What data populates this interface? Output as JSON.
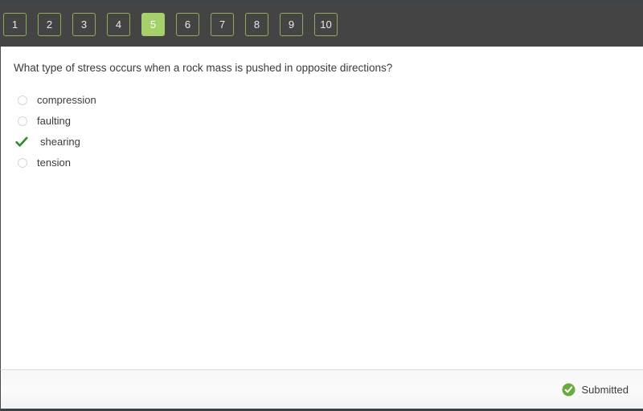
{
  "nav": {
    "buttons": [
      {
        "label": "1",
        "active": false
      },
      {
        "label": "2",
        "active": false
      },
      {
        "label": "3",
        "active": false
      },
      {
        "label": "4",
        "active": false
      },
      {
        "label": "5",
        "active": true
      },
      {
        "label": "6",
        "active": false
      },
      {
        "label": "7",
        "active": false
      },
      {
        "label": "8",
        "active": false
      },
      {
        "label": "9",
        "active": false
      },
      {
        "label": "10",
        "active": false
      }
    ],
    "active_index": 5,
    "active_color": "#a6d06a",
    "border_color": "#8fae5c",
    "background_color": "#444444"
  },
  "question": {
    "text": "What type of stress occurs when a rock mass is pushed in opposite directions?",
    "options": [
      {
        "label": "compression",
        "state": "unselected",
        "marker": "radio-icon"
      },
      {
        "label": "faulting",
        "state": "unselected",
        "marker": "radio-icon"
      },
      {
        "label": "shearing",
        "state": "selected",
        "marker": "check-icon"
      },
      {
        "label": "tension",
        "state": "unselected",
        "marker": "radio-icon"
      }
    ],
    "selected_answer": "shearing",
    "check_color": "#2d8a2d"
  },
  "footer": {
    "status_label": "Submitted",
    "status_icon": "check-circle-icon",
    "status_color": "#6aab3e"
  }
}
